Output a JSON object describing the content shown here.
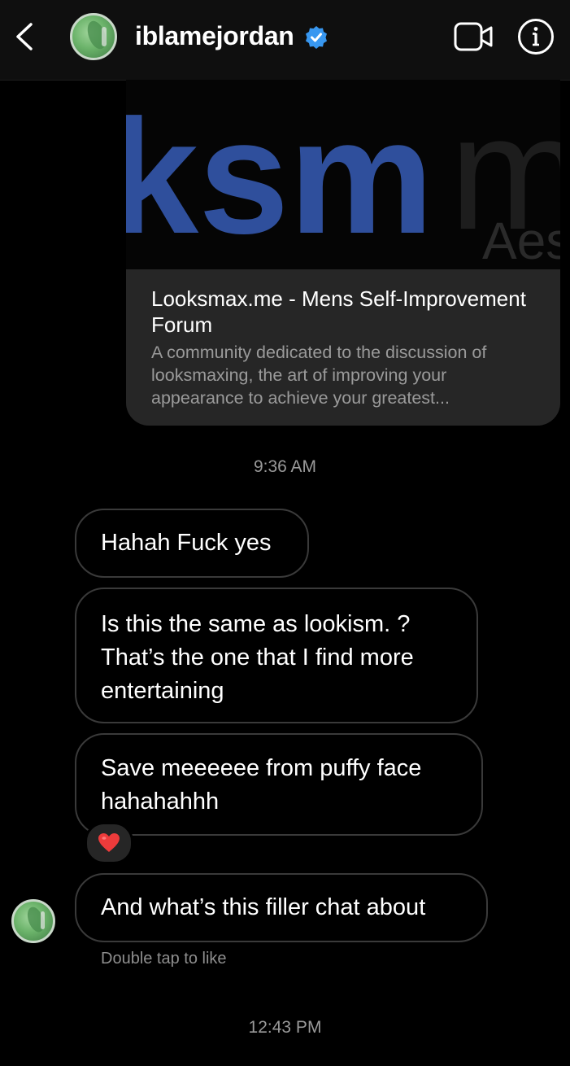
{
  "header": {
    "username": "iblamejordan",
    "icons": {
      "back": "chevron-left-icon",
      "verified": "verified-badge-icon",
      "video": "video-camera-icon",
      "info": "info-icon"
    }
  },
  "link_preview": {
    "image_text": {
      "logo": "ksm",
      "tagline": "Aes"
    },
    "title": "Looksmax.me - Mens Self-Improvement Forum",
    "description": "A community dedicated to the discussion of looksmaxing, the art of improving your appearance to achieve your greatest..."
  },
  "timestamps": [
    "9:36 AM",
    "12:43 PM"
  ],
  "messages": [
    {
      "text": "Hahah Fuck yes"
    },
    {
      "text": "Is this the same as lookism. ? That’s the one that I find more entertaining"
    },
    {
      "text": "Save meeeeee from puffy face hahahahhh",
      "reaction": "❤️"
    },
    {
      "text": "And what’s this filler chat about"
    }
  ],
  "hint": "Double tap to like",
  "colors": {
    "background": "#000000",
    "bubble_border": "#3a3a3a",
    "card": "#262626",
    "verified": "#3897f0",
    "secondary_text": "#9a9a9a"
  }
}
